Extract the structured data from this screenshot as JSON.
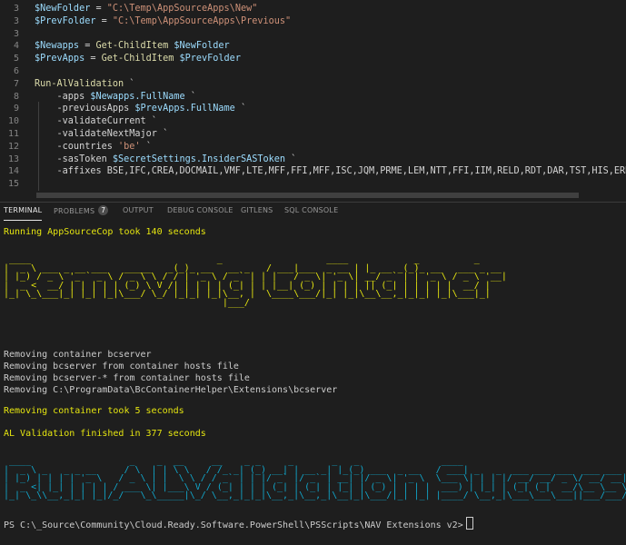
{
  "editor": {
    "lines": [
      {
        "num": "3",
        "parts": [
          {
            "t": "$NewFolder",
            "c": "var"
          },
          {
            "t": " = ",
            "c": "op"
          },
          {
            "t": "\"C:\\Temp\\AppSourceApps\\New\"",
            "c": "str"
          }
        ]
      },
      {
        "num": "3",
        "parts": [
          {
            "t": "$PrevFolder",
            "c": "var"
          },
          {
            "t": " = ",
            "c": "op"
          },
          {
            "t": "\"C:\\Temp\\AppSourceApps\\Previous\"",
            "c": "str"
          }
        ]
      },
      {
        "num": "3",
        "parts": []
      },
      {
        "num": "4",
        "parts": [
          {
            "t": "$Newapps",
            "c": "var"
          },
          {
            "t": " = ",
            "c": "op"
          },
          {
            "t": "Get-ChildItem",
            "c": "cmd"
          },
          {
            "t": " ",
            "c": "plain"
          },
          {
            "t": "$NewFolder",
            "c": "var"
          }
        ]
      },
      {
        "num": "5",
        "parts": [
          {
            "t": "$PrevApps",
            "c": "var"
          },
          {
            "t": " = ",
            "c": "op"
          },
          {
            "t": "Get-ChildItem",
            "c": "cmd"
          },
          {
            "t": " ",
            "c": "plain"
          },
          {
            "t": "$PrevFolder",
            "c": "var"
          }
        ]
      },
      {
        "num": "6",
        "parts": []
      },
      {
        "num": "7",
        "parts": [
          {
            "t": "Run-AlValidation",
            "c": "cmd"
          },
          {
            "t": " `",
            "c": "plain"
          }
        ]
      },
      {
        "num": "8",
        "parts": [
          {
            "t": "    -apps ",
            "c": "param"
          },
          {
            "t": "$Newapps",
            "c": "var"
          },
          {
            "t": ".FullName",
            "c": "prop"
          },
          {
            "t": " `",
            "c": "plain"
          }
        ]
      },
      {
        "num": "9",
        "parts": [
          {
            "t": "    -previousApps ",
            "c": "param"
          },
          {
            "t": "$PrevApps",
            "c": "var"
          },
          {
            "t": ".FullName",
            "c": "prop"
          },
          {
            "t": " `",
            "c": "plain"
          }
        ]
      },
      {
        "num": "10",
        "parts": [
          {
            "t": "    -validateCurrent `",
            "c": "param"
          }
        ]
      },
      {
        "num": "11",
        "parts": [
          {
            "t": "    -validateNextMajor `",
            "c": "param"
          }
        ]
      },
      {
        "num": "12",
        "parts": [
          {
            "t": "    -countries ",
            "c": "param"
          },
          {
            "t": "'be'",
            "c": "str"
          },
          {
            "t": " `",
            "c": "plain"
          }
        ]
      },
      {
        "num": "13",
        "parts": [
          {
            "t": "    -sasToken ",
            "c": "param"
          },
          {
            "t": "$SecretSettings",
            "c": "var"
          },
          {
            "t": ".InsiderSASToken",
            "c": "prop"
          },
          {
            "t": " `",
            "c": "plain"
          }
        ]
      },
      {
        "num": "14",
        "parts": [
          {
            "t": "    -affixes BSE,IFC,CREA,DOCMAIL,VMF,LTE,MFF,FFI,MFF,ISC,JQM,PRME,LEM,NTT,FFI,IIM,RELD,RDT,DAR,TST,HIS,ERR,ICON,R",
            "c": "param"
          }
        ]
      },
      {
        "num": "15",
        "parts": []
      }
    ]
  },
  "tabs": [
    {
      "label": "TERMINAL",
      "active": true
    },
    {
      "label": "PROBLEMS",
      "badge": "7"
    },
    {
      "label": "OUTPUT"
    },
    {
      "label": "DEBUG CONSOLE"
    },
    {
      "label": "GITLENS"
    },
    {
      "label": "SQL CONSOLE"
    }
  ],
  "terminal": {
    "line_cop": "Running AppSourceCop took 140 seconds",
    "banner_removing": [
      " ____                                  _                   ____            _          _                     ",
      "|  _ \\ ___ _ __ ___   _____   _(_)_ __   __ _   / ___|___  _ __ | |_ __ _(_)_ __   ___ _ __ ",
      "| |_) / _ \\ '_ ` _ \\ / _ \\ \\ / / | '_ \\ / _` | | |   / _ \\| '_ \\| __/ _` | | '_ \\ / _ \\ '__|",
      "|  _ <  __/ | | | | | (_) \\ V /| | | | | (_| | | |__| (_) | | | | || (_| | | | | |  __/ |   ",
      "|_| \\_\\___|_| |_| |_|\\___/ \\_/ |_|_| |_|\\__, |  \\____\\___/|_| |_|\\__\\__,_|_|_| |_|\\___|_|   ",
      "                                        |___/                                                "
    ],
    "removing_lines": [
      "Removing container bcserver",
      "Removing bcserver from container hosts file",
      "Removing bcserver-* from container hosts file",
      "Removing C:\\ProgramData\\BcContainerHelper\\Extensions\\bcserver"
    ],
    "line_removing_took": "Removing container took 5 seconds",
    "line_al_finished": "AL Validation finished in 377 seconds",
    "banner_success": [
      " ____                  _    _  __     __    _ _     _       _   _               ____                               ",
      "|  _ \\ _   _ _ __     / \\  | | \\ \\   / /_ _| (_) __| | __ _| |_(_) ___  _ __   / ___| _   _  ___ ___ ___  ___ ___ ",
      "| |_) | | | | '_ \\   / _ \\ | |  \\ \\ / / _` | | |/ _` |/ _` | __| |/ _ \\| '_ \\  \\___ \\| | | |/ __/ __/ _ \\/ __/ __|",
      "|  _ <| |_| | | | | / ___ \\| |___\\ V / (_| | | | (_| | (_| | |_| | (_) | | | |  ___) | |_| | (_| (_|  __/\\__ \\__ \\",
      "|_| \\_\\\\__,_|_| |_|/_/   \\_\\_____|\\_/ \\__,_|_|_|\\__,_|\\__,_|\\__|_|\\___/|_| |_| |____/ \\__,_|\\___\\___\\___||___/___/"
    ],
    "prompt": "PS C:\\_Source\\Community\\Cloud.Ready.Software.PowerShell\\PSScripts\\NAV Extensions v2>"
  },
  "colors": {
    "yellow": "#e5e510",
    "teal": "#11a8cd",
    "background": "#1e1e1e"
  }
}
